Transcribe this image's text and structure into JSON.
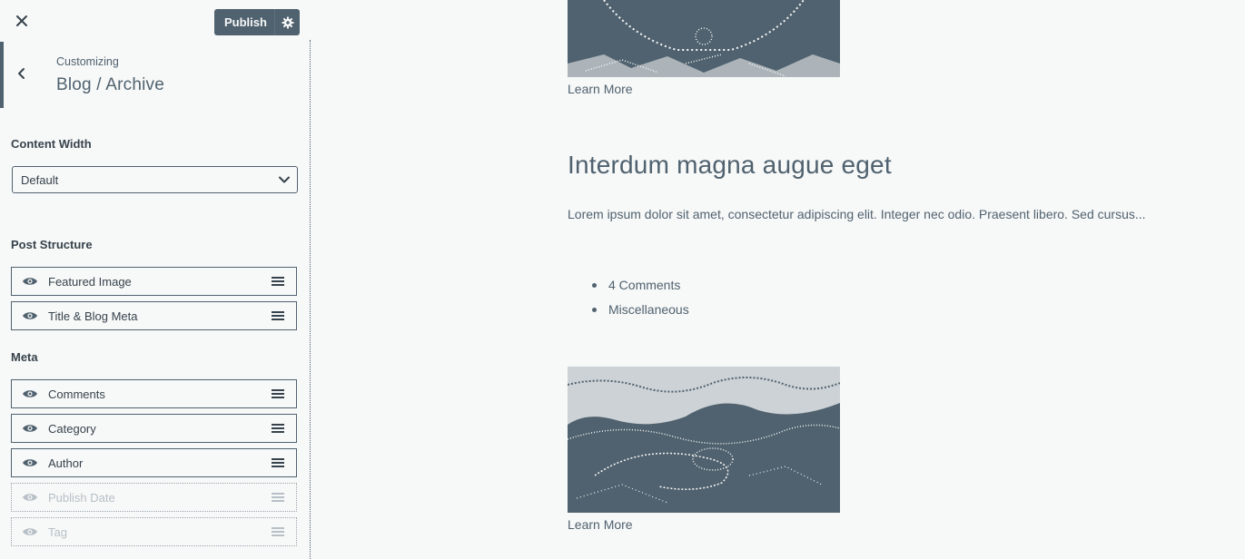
{
  "colors": {
    "accent": "#50626f",
    "background": "#f7f8f8",
    "text_dark": "#37434c",
    "muted": "#b7c0c6"
  },
  "topbar": {
    "close_icon": "close-icon",
    "publish_label": "Publish",
    "settings_icon": "gear-icon"
  },
  "section": {
    "back_icon": "chevron-left-icon",
    "breadcrumb": "Customizing",
    "title": "Blog / Archive"
  },
  "content_width": {
    "label": "Content Width",
    "selected": "Default"
  },
  "post_structure": {
    "label": "Post Structure",
    "items": [
      {
        "label": "Featured Image",
        "visible": true
      },
      {
        "label": "Title & Blog Meta",
        "visible": true
      }
    ]
  },
  "meta": {
    "label": "Meta",
    "items": [
      {
        "label": "Comments",
        "visible": true
      },
      {
        "label": "Category",
        "visible": true
      },
      {
        "label": "Author",
        "visible": true
      },
      {
        "label": "Publish Date",
        "visible": false
      },
      {
        "label": "Tag",
        "visible": false
      }
    ]
  },
  "preview": {
    "top_learn_more": "Learn More",
    "post": {
      "title": "Interdum magna augue eget",
      "excerpt": "Lorem ipsum dolor sit amet, consectetur adipiscing elit. Integer nec odio. Praesent libero. Sed cursus...",
      "meta": [
        "4 Comments",
        "Miscellaneous"
      ],
      "learn_more": "Learn More"
    }
  }
}
